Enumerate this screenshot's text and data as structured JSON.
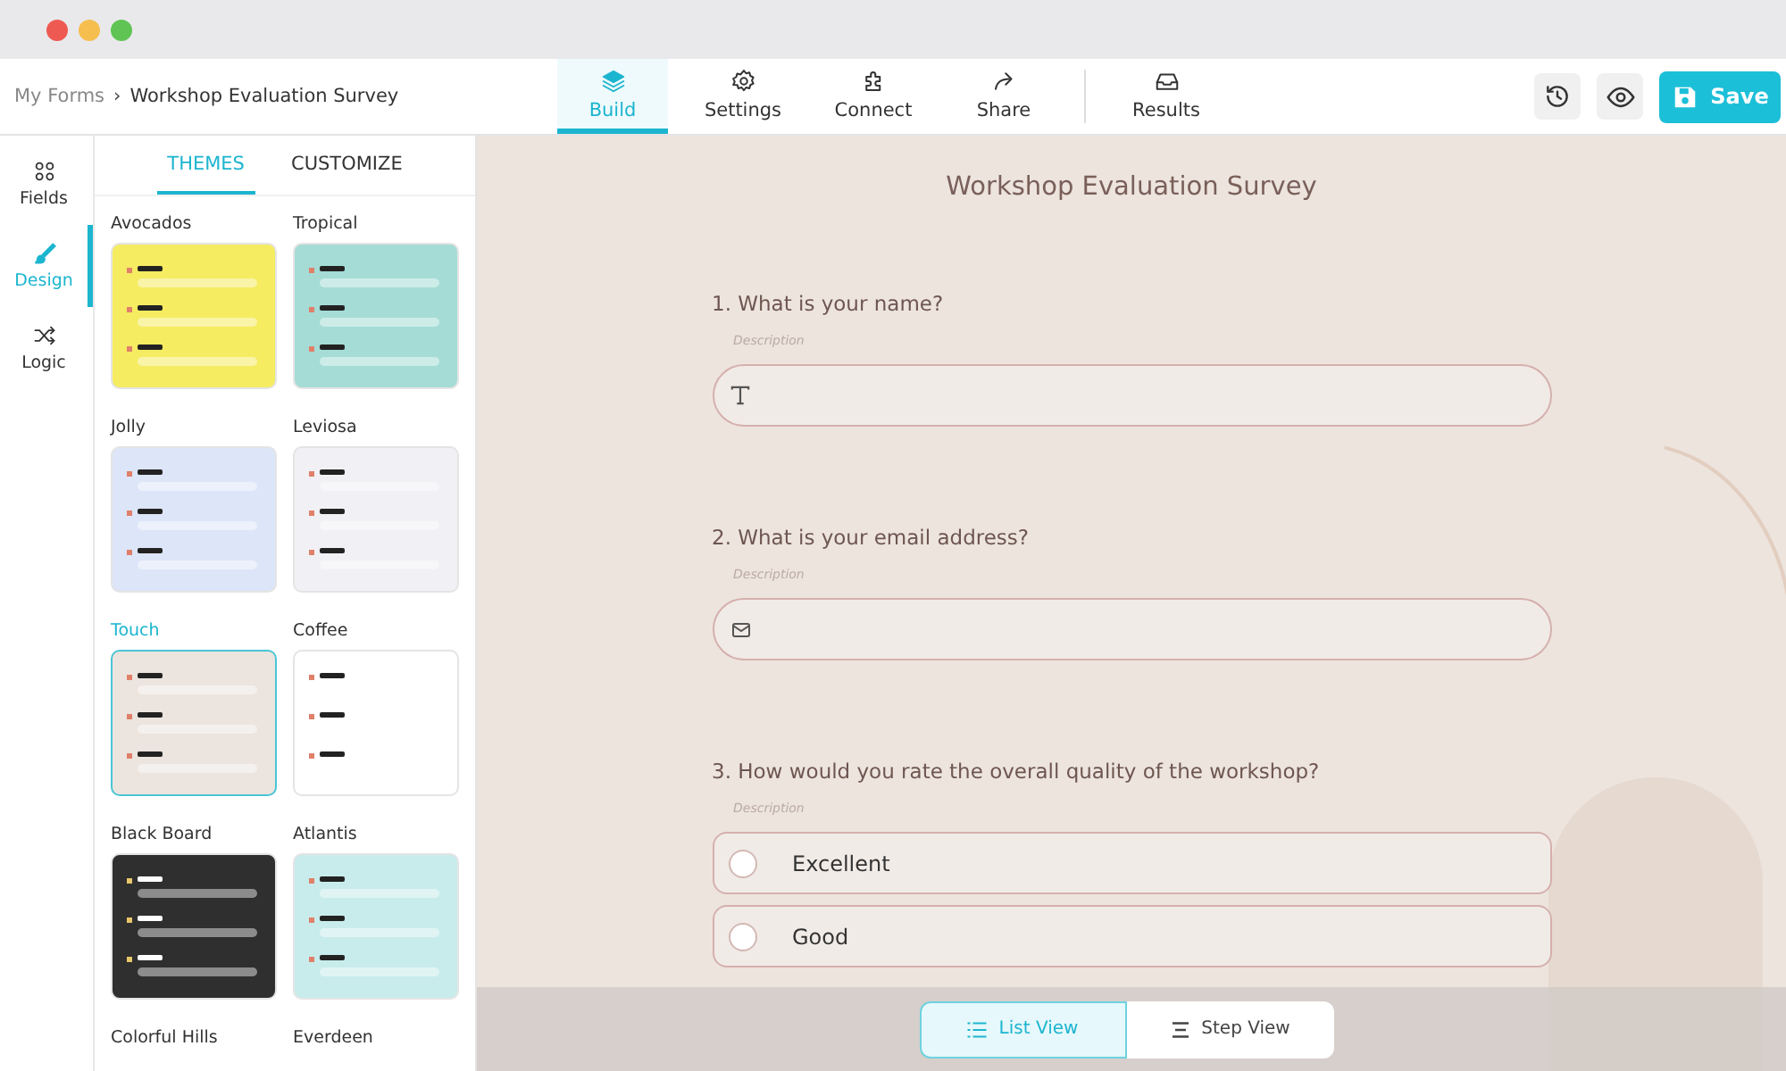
{
  "breadcrumb": {
    "parent": "My Forms",
    "separator": "›",
    "current": "Workshop Evaluation Survey"
  },
  "nav_tabs": [
    {
      "label": "Build",
      "kind": "layers",
      "selected": true
    },
    {
      "label": "Settings",
      "kind": "gear",
      "selected": false
    },
    {
      "label": "Connect",
      "kind": "puzzle",
      "selected": false
    },
    {
      "label": "Share",
      "kind": "share",
      "selected": false
    },
    {
      "label": "Results",
      "kind": "inbox",
      "selected": false
    }
  ],
  "save_button": {
    "label": "Save"
  },
  "sidebar": {
    "items": [
      {
        "label": "Fields",
        "kind": "grid",
        "selected": false
      },
      {
        "label": "Design",
        "kind": "brush",
        "selected": true
      },
      {
        "label": "Logic",
        "kind": "shuffle",
        "selected": false
      }
    ]
  },
  "panel_tabs": [
    {
      "label": "THEMES",
      "selected": true
    },
    {
      "label": "CUSTOMIZE",
      "selected": false
    }
  ],
  "themes": [
    {
      "name": "Avocados",
      "selected": false,
      "color": "#f5ec62"
    },
    {
      "name": "Tropical",
      "selected": false,
      "color": "#a5dcd6"
    },
    {
      "name": "Jolly",
      "selected": false,
      "color": "#dde5f8"
    },
    {
      "name": "Leviosa",
      "selected": false,
      "color": "#f1f1f5"
    },
    {
      "name": "Touch",
      "selected": true,
      "color": "#ece4de"
    },
    {
      "name": "Coffee",
      "selected": false,
      "color": "#ffffff"
    },
    {
      "name": "Black Board",
      "selected": false,
      "color": "#2f2f2f"
    },
    {
      "name": "Atlantis",
      "selected": false,
      "color": "#c8ecec"
    },
    {
      "name": "Colorful Hills",
      "selected": false
    },
    {
      "name": "Everdeen",
      "selected": false
    }
  ],
  "form": {
    "title": "Workshop Evaluation Survey",
    "questions": [
      {
        "kind": "text",
        "label": "1. What is your name?",
        "description": "Description"
      },
      {
        "kind": "email",
        "label": "2. What is your email address?",
        "description": "Description"
      },
      {
        "kind": "choice",
        "label": "3. How would you rate the overall quality of the workshop?",
        "description": "Description",
        "options": [
          {
            "label": "Excellent",
            "selected": false
          },
          {
            "label": "Good",
            "selected": false
          }
        ]
      }
    ]
  },
  "view_toggle": [
    {
      "label": "List View",
      "kind": "list",
      "selected": true
    },
    {
      "label": "Step View",
      "kind": "step",
      "selected": false
    }
  ]
}
